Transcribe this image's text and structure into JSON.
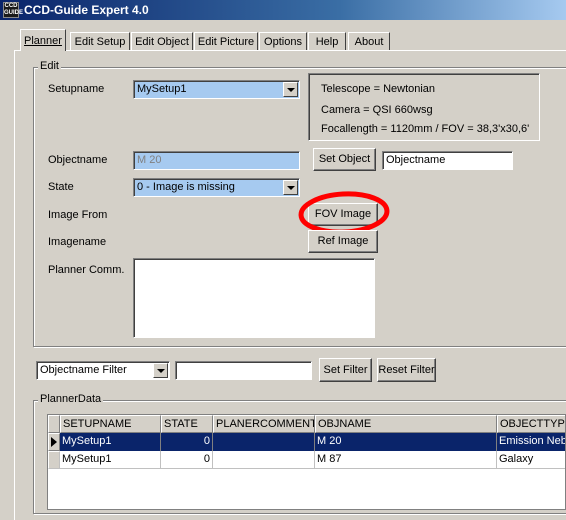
{
  "window": {
    "title": "CCD-Guide Expert 4.0",
    "icon_text": "CCD GUIDE"
  },
  "tabs": [
    {
      "label": "Planner",
      "active": true
    },
    {
      "label": "Edit Setup"
    },
    {
      "label": "Edit Object"
    },
    {
      "label": "Edit Picture"
    },
    {
      "label": "Options"
    },
    {
      "label": "Help"
    },
    {
      "label": "About"
    }
  ],
  "edit": {
    "group_label": "Edit",
    "setupname_label": "Setupname",
    "setupname_value": "MySetup1",
    "info": {
      "telescope": "Telescope =  Newtonian",
      "camera": "Camera = QSI 660wsg",
      "focal": "Focallength = 1120mm / FOV = 38,3'x30,6'"
    },
    "objectname_label": "Objectname",
    "objectname_value": "M 20",
    "set_object_button": "Set Object",
    "objectname_input": "Objectname",
    "state_label": "State",
    "state_value": "0 - Image is missing",
    "image_from_label": "Image From",
    "fov_image_button": "FOV Image",
    "imagename_label": "Imagename",
    "ref_image_button": "Ref Image",
    "planner_comm_label": "Planner Comm.",
    "planner_comm_value": ""
  },
  "filter": {
    "select_value": "Objectname Filter",
    "input_value": "",
    "set_filter_button": "Set Filter",
    "reset_filter_button": "Reset Filter"
  },
  "planner_data": {
    "group_label": "PlannerData",
    "columns": [
      "SETUPNAME",
      "STATE",
      "PLANERCOMMENT",
      "OBJNAME",
      "OBJECTTYPE"
    ],
    "rows": [
      {
        "setupname": "MySetup1",
        "state": "0",
        "comment": "",
        "objname": "M 20",
        "objecttype": "Emission Nebula",
        "selected": true
      },
      {
        "setupname": "MySetup1",
        "state": "0",
        "comment": "",
        "objname": "M 87",
        "objecttype": "Galaxy",
        "selected": false
      }
    ]
  },
  "colors": {
    "highlight_circle": "#ff0000",
    "selection": "#0a246a",
    "combo_bg": "#a6caf0"
  }
}
